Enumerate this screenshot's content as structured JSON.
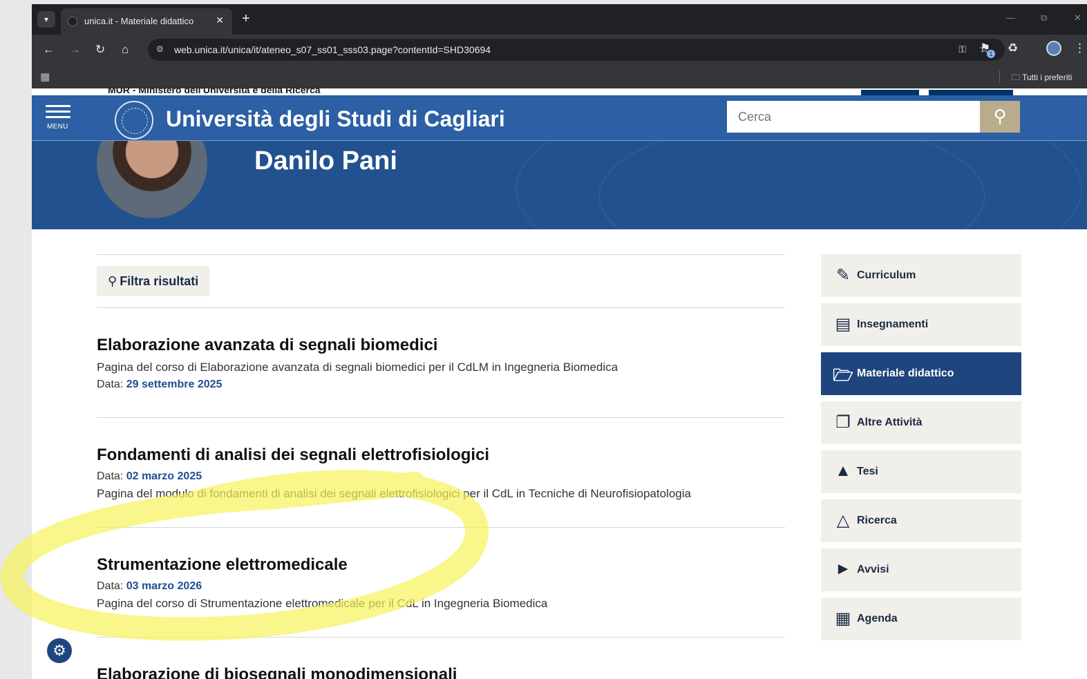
{
  "browser": {
    "tab_title": "unica.it - Materiale didattico",
    "url": "web.unica.it/unica/it/ateneo_s07_ss01_sss03.page?contentId=SHD30694",
    "extension_badge": "1",
    "bookmarks_all": "Tutti i preferiti"
  },
  "header": {
    "menu_label": "MENU",
    "university_name": "Università degli Studi di Cagliari",
    "search_placeholder": "Cerca"
  },
  "topstrip": {
    "mur_text": "MUR - Ministero dell'Università e della Ricerca"
  },
  "profile": {
    "name": "Danilo Pani"
  },
  "content": {
    "filter_label": "Filtra risultati",
    "date_label": "Data:",
    "items": [
      {
        "title": "Elaborazione avanzata di segnali biomedici",
        "description": "Pagina del corso di Elaborazione avanzata di segnali biomedici per il CdLM in Ingegneria Biomedica",
        "date": "29 settembre 2025"
      },
      {
        "title": "Fondamenti di analisi dei segnali elettrofisiologici",
        "date": "02 marzo 2025",
        "description": "Pagina del modulo di fondamenti di analisi dei segnali elettrofisiologici per il CdL in Tecniche di Neurofisiopatologia"
      },
      {
        "title": "Strumentazione elettromedicale",
        "date": "03 marzo 2026",
        "description": "Pagina del corso di Strumentazione elettromedicale per il CdL in Ingegneria Biomedica"
      },
      {
        "title": "Elaborazione di biosegnali monodimensionali"
      }
    ]
  },
  "sidebar": {
    "items": [
      {
        "label": "Curriculum",
        "icon": "edit-icon"
      },
      {
        "label": "Insegnamenti",
        "icon": "book-icon"
      },
      {
        "label": "Materiale didattico",
        "icon": "folder-open-icon",
        "active": true
      },
      {
        "label": "Altre Attività",
        "icon": "documents-icon"
      },
      {
        "label": "Tesi",
        "icon": "graduation-cap-icon"
      },
      {
        "label": "Ricerca",
        "icon": "flask-icon"
      },
      {
        "label": "Avvisi",
        "icon": "megaphone-icon"
      },
      {
        "label": "Agenda",
        "icon": "calendar-icon"
      }
    ]
  },
  "colors": {
    "header_blue": "#2c5fa3",
    "hero_blue": "#22518f",
    "active_blue": "#1e457e",
    "search_button": "#b9ac8c",
    "sidebar_bg": "#f1efea",
    "highlight": "#f7f25a"
  }
}
